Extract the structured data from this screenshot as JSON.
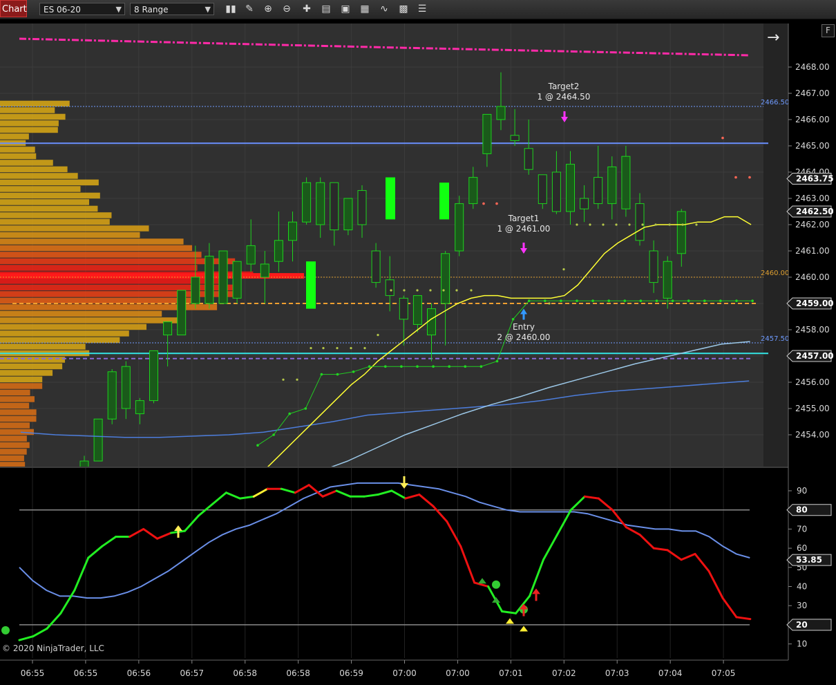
{
  "toolbar": {
    "chart_tab": "Chart",
    "instrument": "ES 06-20",
    "period": "8 Range",
    "icons": [
      "bar-type-icon",
      "pencil-icon",
      "zoom-in-icon",
      "zoom-out-icon",
      "crosshair-icon",
      "properties-icon",
      "data-box-icon",
      "strategy-icon",
      "template-icon",
      "list-icon"
    ]
  },
  "copyright": "© 2020 NinjaTrader, LLC",
  "f_button": "F",
  "colors": {
    "up_bar": "#1ed31e",
    "trend_up": "#22ee22",
    "trend_down": "#ee1111",
    "ema": "#ffff33",
    "magenta": "#ff2aa8",
    "cyan": "#33dddd"
  },
  "chart_data": [
    {
      "type": "candlestick",
      "price_axis_labels": [
        "2468.00",
        "2467.00",
        "2466.00",
        "2465.00",
        "2464.00",
        "2463.00",
        "2462.00",
        "2461.00",
        "2460.00",
        "2459.00",
        "2458.00",
        "2457.00",
        "2456.00",
        "2455.00",
        "2454.00"
      ],
      "price_tags": [
        {
          "label": "2463.75",
          "value": 2463.75
        },
        {
          "label": "2462.50",
          "value": 2462.5
        },
        {
          "label": "2459.00",
          "value": 2459.0
        },
        {
          "label": "2457.00",
          "value": 2457.0
        }
      ],
      "level_labels": [
        {
          "label": "2466.50",
          "value": 2466.5,
          "color": "#6f9bff"
        },
        {
          "label": "2460.00",
          "value": 2460.0,
          "color": "#e0a030"
        },
        {
          "label": "2457.50",
          "value": 2457.5,
          "color": "#6f9bff"
        }
      ],
      "time_labels": [
        "06:55",
        "06:55",
        "06:56",
        "06:57",
        "06:58",
        "06:58",
        "06:59",
        "07:00",
        "07:00",
        "07:01",
        "07:02",
        "07:03",
        "07:04",
        "07:05"
      ],
      "annotations": [
        {
          "line1": "Target2",
          "line2": "1 @ 2464.50",
          "time_index": 16.5,
          "value": 2467.2
        },
        {
          "line1": "Target1",
          "line2": "1 @ 2461.00",
          "time_index": 13.2,
          "value": 2462.0
        },
        {
          "line1": "Entry",
          "line2": "2 @ 2460.00",
          "time_index": 13.1,
          "value": 2457.6
        }
      ],
      "candles": [
        {
          "o": 2452.4,
          "h": 2453.2,
          "l": 2452.0,
          "c": 2453.0
        },
        {
          "o": 2453.0,
          "h": 2454.6,
          "l": 2453.0,
          "c": 2454.6
        },
        {
          "o": 2454.6,
          "h": 2456.5,
          "l": 2454.4,
          "c": 2456.4
        },
        {
          "o": 2455.0,
          "h": 2456.8,
          "l": 2454.6,
          "c": 2456.6
        },
        {
          "o": 2454.8,
          "h": 2455.4,
          "l": 2454.4,
          "c": 2455.3
        },
        {
          "o": 2455.3,
          "h": 2457.2,
          "l": 2455.2,
          "c": 2457.2
        },
        {
          "o": 2457.8,
          "h": 2458.3,
          "l": 2456.6,
          "c": 2458.3
        },
        {
          "o": 2457.8,
          "h": 2459.0,
          "l": 2457.8,
          "c": 2459.5
        },
        {
          "o": 2459.0,
          "h": 2461.2,
          "l": 2458.8,
          "c": 2460.0
        },
        {
          "o": 2459.0,
          "h": 2461.3,
          "l": 2458.8,
          "c": 2460.8
        },
        {
          "o": 2459.0,
          "h": 2461.0,
          "l": 2459.0,
          "c": 2461.0
        },
        {
          "o": 2459.2,
          "h": 2460.6,
          "l": 2459.0,
          "c": 2460.6
        },
        {
          "o": 2460.5,
          "h": 2462.2,
          "l": 2460.2,
          "c": 2461.2
        },
        {
          "o": 2460.0,
          "h": 2461.0,
          "l": 2459.0,
          "c": 2460.5
        },
        {
          "o": 2460.6,
          "h": 2462.5,
          "l": 2460.2,
          "c": 2461.4
        },
        {
          "o": 2461.4,
          "h": 2462.5,
          "l": 2460.6,
          "c": 2462.1
        },
        {
          "o": 2462.1,
          "h": 2463.8,
          "l": 2462.0,
          "c": 2463.6
        },
        {
          "o": 2462.0,
          "h": 2463.8,
          "l": 2461.5,
          "c": 2463.6
        },
        {
          "o": 2463.6,
          "h": 2463.6,
          "l": 2461.2,
          "c": 2461.8
        },
        {
          "o": 2461.8,
          "h": 2463.0,
          "l": 2461.6,
          "c": 2463.0
        },
        {
          "o": 2463.3,
          "h": 2463.5,
          "l": 2461.5,
          "c": 2462.0
        },
        {
          "o": 2461.0,
          "h": 2461.3,
          "l": 2459.6,
          "c": 2459.8
        },
        {
          "o": 2459.9,
          "h": 2460.8,
          "l": 2458.7,
          "c": 2459.3
        },
        {
          "o": 2459.2,
          "h": 2459.3,
          "l": 2457.4,
          "c": 2458.4
        },
        {
          "o": 2458.2,
          "h": 2459.3,
          "l": 2457.9,
          "c": 2459.3
        },
        {
          "o": 2457.8,
          "h": 2459.0,
          "l": 2456.8,
          "c": 2458.8
        },
        {
          "o": 2459.0,
          "h": 2461.0,
          "l": 2457.4,
          "c": 2460.9
        },
        {
          "o": 2461.0,
          "h": 2463.1,
          "l": 2460.8,
          "c": 2462.8
        },
        {
          "o": 2462.8,
          "h": 2464.2,
          "l": 2462.6,
          "c": 2463.8
        },
        {
          "o": 2464.7,
          "h": 2466.2,
          "l": 2464.2,
          "c": 2466.2
        },
        {
          "o": 2466.0,
          "h": 2467.8,
          "l": 2465.6,
          "c": 2466.5
        },
        {
          "o": 2465.4,
          "h": 2466.4,
          "l": 2465.0,
          "c": 2465.2
        },
        {
          "o": 2464.9,
          "h": 2466.0,
          "l": 2463.9,
          "c": 2464.1
        },
        {
          "o": 2463.9,
          "h": 2463.9,
          "l": 2462.6,
          "c": 2462.8
        },
        {
          "o": 2464.0,
          "h": 2464.8,
          "l": 2462.4,
          "c": 2462.5
        },
        {
          "o": 2462.5,
          "h": 2464.8,
          "l": 2462.0,
          "c": 2464.3
        },
        {
          "o": 2463.0,
          "h": 2463.5,
          "l": 2462.1,
          "c": 2462.6
        },
        {
          "o": 2463.8,
          "h": 2465.0,
          "l": 2462.6,
          "c": 2462.8
        },
        {
          "o": 2462.8,
          "h": 2464.6,
          "l": 2462.2,
          "c": 2464.2
        },
        {
          "o": 2462.6,
          "h": 2465.0,
          "l": 2462.3,
          "c": 2464.6
        },
        {
          "o": 2462.8,
          "h": 2463.2,
          "l": 2461.2,
          "c": 2461.4
        },
        {
          "o": 2461.0,
          "h": 2461.4,
          "l": 2459.4,
          "c": 2459.8
        },
        {
          "o": 2459.2,
          "h": 2460.8,
          "l": 2458.8,
          "c": 2460.6
        },
        {
          "o": 2460.9,
          "h": 2462.6,
          "l": 2460.4,
          "c": 2462.5
        }
      ],
      "ema": [
        2452.4,
        2452.9,
        2453.4,
        2453.9,
        2454.4,
        2454.9,
        2455.4,
        2455.9,
        2456.3,
        2456.8,
        2457.2,
        2457.6,
        2458.0,
        2458.4,
        2458.7,
        2459.0,
        2459.2,
        2459.3,
        2459.3,
        2459.2,
        2459.2,
        2459.2,
        2459.2,
        2459.3,
        2459.7,
        2460.3,
        2460.9,
        2461.3,
        2461.6,
        2461.9,
        2462.0,
        2462.0,
        2462.0,
        2462.1,
        2462.1,
        2462.3,
        2462.3,
        2462.0
      ],
      "slow_ma": [
        2454.1,
        2454.0,
        2453.95,
        2453.9,
        2453.9,
        2453.95,
        2454.0,
        2454.1,
        2454.3,
        2454.5,
        2454.75,
        2454.85,
        2454.95,
        2455.05,
        2455.15,
        2455.3,
        2455.5,
        2455.65,
        2455.75,
        2455.85,
        2455.95,
        2456.05
      ],
      "mid_ma": [
        2452.3,
        2452.6,
        2453.0,
        2453.5,
        2454.0,
        2454.4,
        2454.8,
        2455.15,
        2455.45,
        2455.8,
        2456.1,
        2456.4,
        2456.7,
        2456.95,
        2457.2,
        2457.45,
        2457.55
      ],
      "trail_stop": [
        2453.6,
        2454.0,
        2454.8,
        2455.0,
        2456.3,
        2456.3,
        2456.4,
        2456.6,
        2456.6,
        2456.6,
        2456.6,
        2456.6,
        2456.6,
        2456.6,
        2456.6,
        2456.8,
        2458.4,
        2459.1,
        2459.1,
        2459.1,
        2459.1,
        2459.1,
        2459.1,
        2459.1,
        2459.1,
        2459.1,
        2459.1,
        2459.1,
        2459.1,
        2459.1,
        2459.1,
        2459.1
      ],
      "levels": [
        {
          "name": "blue-line",
          "value": 2465.1,
          "color": "#5f87ff"
        },
        {
          "name": "cyan-line",
          "value": 2457.1,
          "color": "#33e6e6"
        },
        {
          "name": "orange-dashed",
          "value": 2459.0,
          "color": "#f0a030"
        }
      ]
    },
    {
      "type": "line",
      "yticks": [
        "90",
        "70",
        "60",
        "50",
        "40",
        "30",
        "10"
      ],
      "tags": [
        {
          "label": "80",
          "value": 80
        },
        {
          "label": "53.85",
          "value": 53.85
        },
        {
          "label": "20",
          "value": 20
        }
      ],
      "bands": [
        80,
        20
      ],
      "fast": [
        12,
        14,
        18,
        26,
        38,
        55,
        61,
        66,
        66,
        70,
        65,
        68,
        69,
        77,
        83,
        89,
        86,
        87,
        91,
        91,
        89,
        93,
        87,
        90,
        87,
        87,
        88,
        90,
        86,
        88,
        82,
        74,
        61,
        42,
        40,
        27,
        26,
        35,
        54,
        67,
        80,
        87,
        86,
        80,
        71,
        67,
        60,
        59,
        54,
        57,
        48,
        34,
        24,
        23
      ],
      "fast_colors": [
        "g",
        "g",
        "g",
        "g",
        "g",
        "g",
        "g",
        "g",
        "g",
        "r",
        "r",
        "r",
        "g",
        "g",
        "g",
        "g",
        "g",
        "g",
        "y",
        "r",
        "g",
        "r",
        "r",
        "r",
        "g",
        "g",
        "g",
        "g",
        "g",
        "r",
        "r",
        "r",
        "r",
        "r",
        "r",
        "g",
        "g",
        "g",
        "g",
        "g",
        "g",
        "g",
        "r",
        "r",
        "r",
        "r",
        "r",
        "r",
        "r",
        "r",
        "r",
        "r",
        "r",
        "r"
      ],
      "slow": [
        50,
        43,
        38,
        35,
        35,
        34,
        34,
        35,
        37,
        40,
        44,
        48,
        53,
        58,
        63,
        67,
        70,
        72,
        75,
        78,
        82,
        86,
        89,
        92,
        93,
        94,
        94,
        94,
        94,
        93,
        92,
        91,
        89,
        87,
        84,
        82,
        80,
        79,
        79,
        79,
        79,
        79,
        78,
        76,
        74,
        72,
        71,
        70,
        70,
        69,
        69,
        66,
        61,
        57,
        55
      ]
    }
  ]
}
